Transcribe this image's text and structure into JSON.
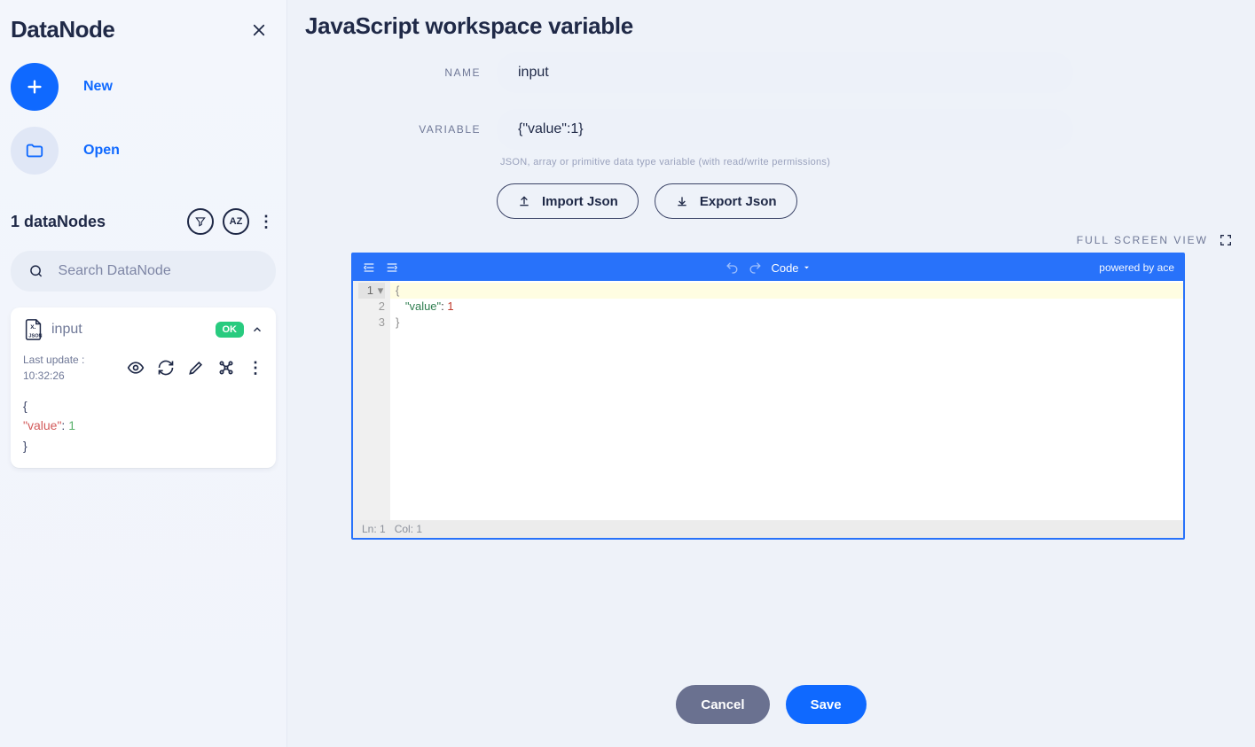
{
  "sidebar": {
    "title": "DataNode",
    "actions": {
      "new": "New",
      "open": "Open"
    },
    "count_text": "1 dataNodes",
    "sort_label": "AZ",
    "search_placeholder": "Search DataNode",
    "card": {
      "name": "input",
      "status": "OK",
      "last_update_label": "Last update :",
      "last_update_value": "10:32:26",
      "preview": {
        "key": "\"value\"",
        "sep": ": ",
        "num": "1"
      }
    }
  },
  "main": {
    "title": "JavaScript workspace variable",
    "name_label": "NAME",
    "name_value": "input",
    "variable_label": "VARIABLE",
    "variable_value": "{\"value\":1}",
    "variable_helper": "JSON, array or primitive data type variable (with read/write permissions)",
    "import_label": "Import Json",
    "export_label": "Export Json",
    "fullscreen_label": "FULL SCREEN VIEW",
    "editor": {
      "code_menu": "Code",
      "powered": "powered by ace",
      "lines": {
        "l1": "{",
        "l2_key": "\"value\"",
        "l2_sep": ": ",
        "l2_num": "1",
        "l3": "}"
      },
      "gutter": {
        "l1": "1",
        "l2": "2",
        "l3": "3",
        "fold": "▾"
      },
      "status": {
        "ln": "Ln: 1",
        "col": "Col: 1"
      }
    },
    "buttons": {
      "cancel": "Cancel",
      "save": "Save"
    }
  }
}
